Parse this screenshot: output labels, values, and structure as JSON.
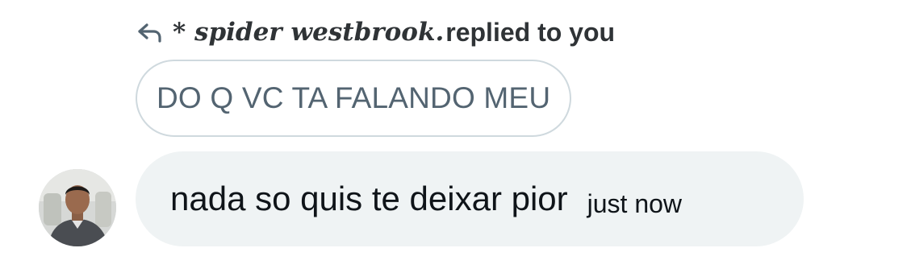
{
  "reply_header": {
    "icon": "reply-arrow-icon",
    "sender_name": "* spider westbrook.",
    "action_text": " replied to you"
  },
  "quoted_message": {
    "text": "DO Q VC TA FALANDO MEU"
  },
  "message": {
    "text": "nada so quis te deixar pior",
    "timestamp": "just now"
  },
  "avatar": {
    "icon": "user-avatar"
  },
  "colors": {
    "bubble_background": "#eff3f4",
    "quoted_border": "#cfd9de",
    "quoted_text": "#536471",
    "primary_text": "#0f1419"
  }
}
